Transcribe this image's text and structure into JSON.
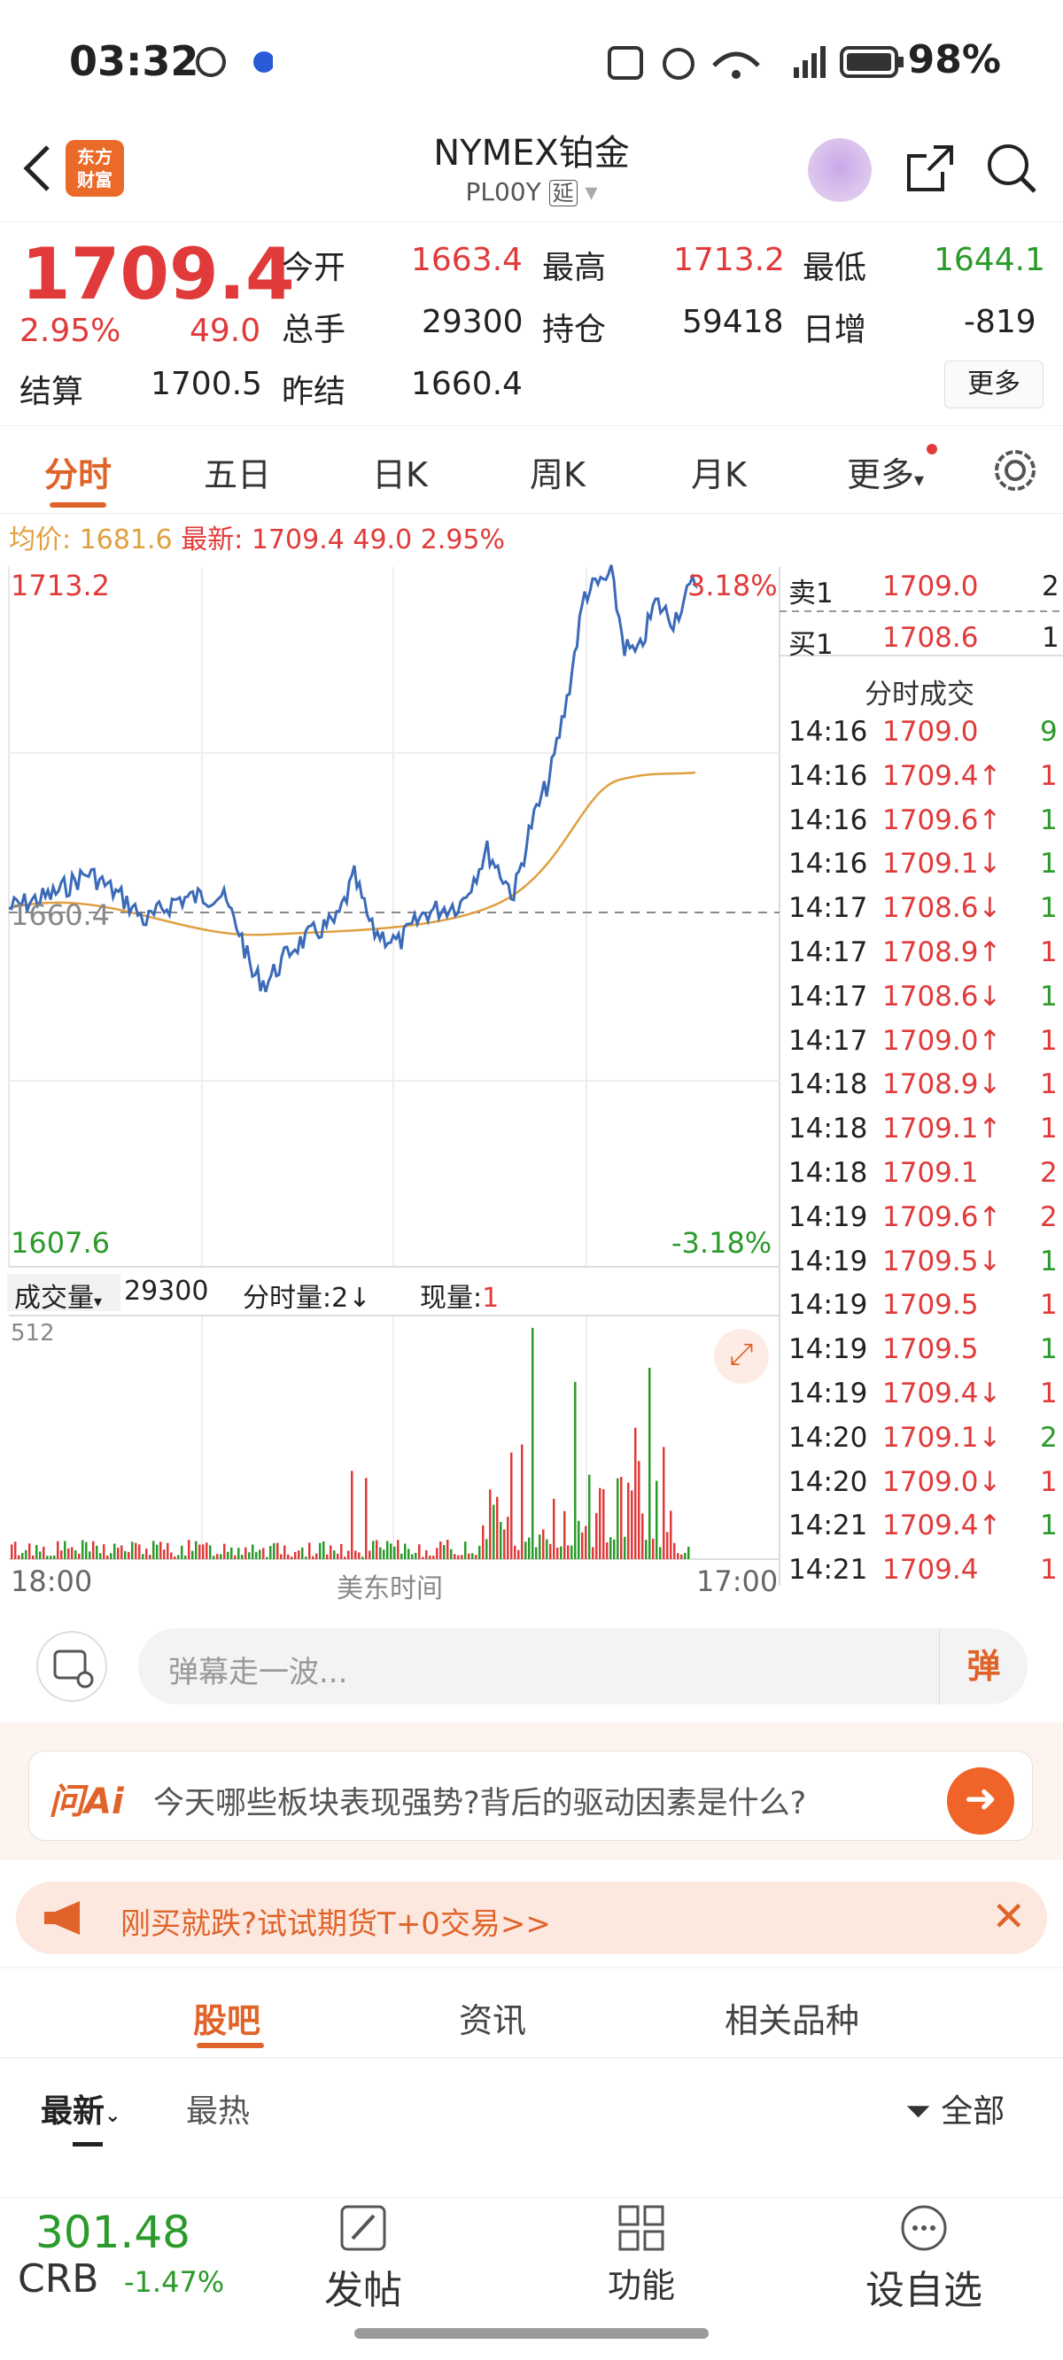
{
  "status": {
    "time": "03:32",
    "battery": "98%",
    "network": "4G"
  },
  "header": {
    "logo": "东方\n财富",
    "title": "NYMEX铂金",
    "code": "PL00Y",
    "code_tag": "延"
  },
  "quote": {
    "price": "1709.4",
    "pct": "2.95%",
    "chg": "49.0",
    "open_label": "今开",
    "open": "1663.4",
    "high_label": "最高",
    "high": "1713.2",
    "low_label": "最低",
    "low": "1644.1",
    "vol_label": "总手",
    "vol": "29300",
    "oi_label": "持仓",
    "oi": "59418",
    "inc_label": "日增",
    "inc": "-819",
    "settle_label": "结算",
    "settle": "1700.5",
    "prev_label": "昨结",
    "prev": "1660.4",
    "more": "更多"
  },
  "tabs": [
    "分时",
    "五日",
    "日K",
    "周K",
    "月K",
    "更多"
  ],
  "avgline": {
    "avg_label": "均价:",
    "avg": "1681.6",
    "last_label": "最新:",
    "last": "1709.4",
    "chg": "49.0",
    "pct": "2.95%"
  },
  "chart_data": {
    "type": "line",
    "title": "",
    "price_top": "1713.2",
    "price_bottom": "1607.6",
    "base": "1660.4",
    "pct_top": "3.18%",
    "pct_bottom": "-3.18%",
    "ylim": [
      1607.6,
      1713.2
    ],
    "x_start": "18:00",
    "x_mid": "美东时间",
    "x_end": "17:00",
    "volume_label": "成交量",
    "volume": "29300",
    "tick_label": "分时量:2↓",
    "now_label": "现量:",
    "now": "1",
    "vol_max": "512"
  },
  "orderbook": {
    "sell_label": "卖1",
    "sell_price": "1709.0",
    "sell_qty": "2",
    "buy_label": "买1",
    "buy_price": "1708.6",
    "buy_qty": "1"
  },
  "ticks_title": "分时成交",
  "ticks": [
    {
      "t": "14:16",
      "p": "1709.0",
      "a": "",
      "q": "9",
      "c": "red",
      "qc": "green"
    },
    {
      "t": "14:16",
      "p": "1709.4",
      "a": "↑",
      "q": "1",
      "c": "red",
      "qc": "red"
    },
    {
      "t": "14:16",
      "p": "1709.6",
      "a": "↑",
      "q": "1",
      "c": "red",
      "qc": "green"
    },
    {
      "t": "14:16",
      "p": "1709.1",
      "a": "↓",
      "q": "1",
      "c": "red",
      "qc": "green"
    },
    {
      "t": "14:17",
      "p": "1708.6",
      "a": "↓",
      "q": "1",
      "c": "red",
      "qc": "green"
    },
    {
      "t": "14:17",
      "p": "1708.9",
      "a": "↑",
      "q": "1",
      "c": "red",
      "qc": "red"
    },
    {
      "t": "14:17",
      "p": "1708.6",
      "a": "↓",
      "q": "1",
      "c": "red",
      "qc": "green"
    },
    {
      "t": "14:17",
      "p": "1709.0",
      "a": "↑",
      "q": "1",
      "c": "red",
      "qc": "red"
    },
    {
      "t": "14:18",
      "p": "1708.9",
      "a": "↓",
      "q": "1",
      "c": "red",
      "qc": "red"
    },
    {
      "t": "14:18",
      "p": "1709.1",
      "a": "↑",
      "q": "1",
      "c": "red",
      "qc": "red"
    },
    {
      "t": "14:18",
      "p": "1709.1",
      "a": "",
      "q": "2",
      "c": "red",
      "qc": "red"
    },
    {
      "t": "14:19",
      "p": "1709.6",
      "a": "↑",
      "q": "2",
      "c": "red",
      "qc": "red"
    },
    {
      "t": "14:19",
      "p": "1709.5",
      "a": "↓",
      "q": "1",
      "c": "red",
      "qc": "green"
    },
    {
      "t": "14:19",
      "p": "1709.5",
      "a": "",
      "q": "1",
      "c": "red",
      "qc": "red"
    },
    {
      "t": "14:19",
      "p": "1709.5",
      "a": "",
      "q": "1",
      "c": "red",
      "qc": "green"
    },
    {
      "t": "14:19",
      "p": "1709.4",
      "a": "↓",
      "q": "1",
      "c": "red",
      "qc": "red"
    },
    {
      "t": "14:20",
      "p": "1709.1",
      "a": "↓",
      "q": "2",
      "c": "red",
      "qc": "green"
    },
    {
      "t": "14:20",
      "p": "1709.0",
      "a": "↓",
      "q": "1",
      "c": "red",
      "qc": "red"
    },
    {
      "t": "14:21",
      "p": "1709.4",
      "a": "↑",
      "q": "1",
      "c": "red",
      "qc": "green"
    },
    {
      "t": "14:21",
      "p": "1709.4",
      "a": "",
      "q": "1",
      "c": "red",
      "qc": "red"
    }
  ],
  "danmu": {
    "placeholder": "弹幕走一波...",
    "btn": "弹"
  },
  "ai": {
    "logo": "问Ai",
    "question": "今天哪些板块表现强势?背后的驱动因素是什么?"
  },
  "promo": {
    "text": "刚买就跌?试试期货T+0交易>>"
  },
  "bottom_tabs": [
    "股吧",
    "资讯",
    "相关品种"
  ],
  "sort": {
    "latest": "最新",
    "hot": "最热",
    "all": "全部"
  },
  "crb": {
    "value": "301.48",
    "name": "CRB",
    "pct": "-1.47%"
  },
  "nav": {
    "post": "发帖",
    "func": "功能",
    "watch": "设自选"
  },
  "colors": {
    "up": "#e03a3a",
    "down": "#2a9a2a",
    "accent": "#e0642a",
    "avg": "#e0a040",
    "price": "#3a6ab8"
  }
}
